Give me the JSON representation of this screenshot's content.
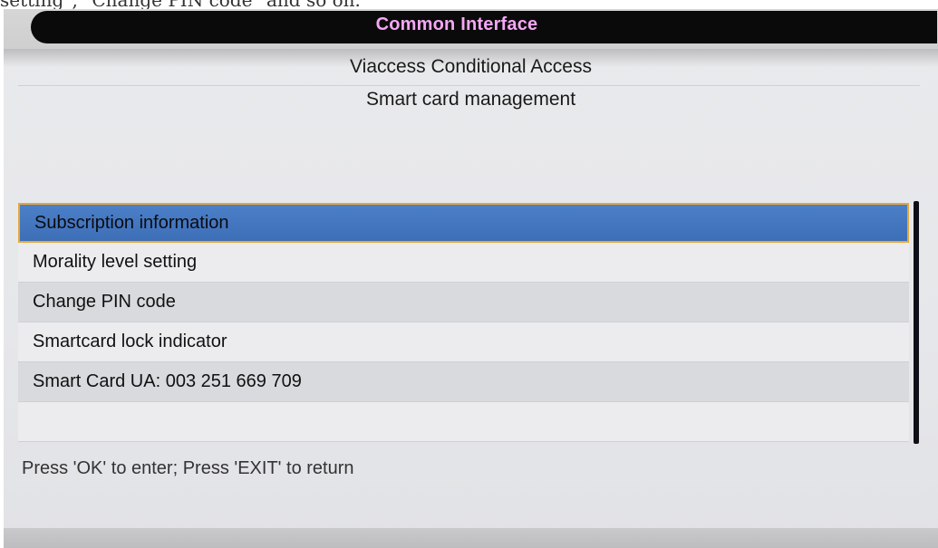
{
  "caption_fragment": "setting\", \"Change PIN code\" and so on.",
  "window": {
    "title": "Common Interface"
  },
  "header": {
    "title": "Viaccess Conditional Access",
    "subtitle": "Smart card management"
  },
  "menu": {
    "items": [
      {
        "label": "Subscription information",
        "selected": true
      },
      {
        "label": "Morality level setting",
        "selected": false
      },
      {
        "label": "Change PIN code",
        "selected": false
      },
      {
        "label": "Smartcard lock indicator",
        "selected": false
      },
      {
        "label": "Smart Card UA: 003 251 669 709",
        "selected": false
      }
    ]
  },
  "footer": {
    "hint": "Press 'OK' to enter; Press 'EXIT' to return"
  },
  "colors": {
    "title_text": "#f4a8f4",
    "selection_fill": "#3d6fb7",
    "selection_border": "#e6a83a",
    "title_bar": "#0a0a0a"
  }
}
